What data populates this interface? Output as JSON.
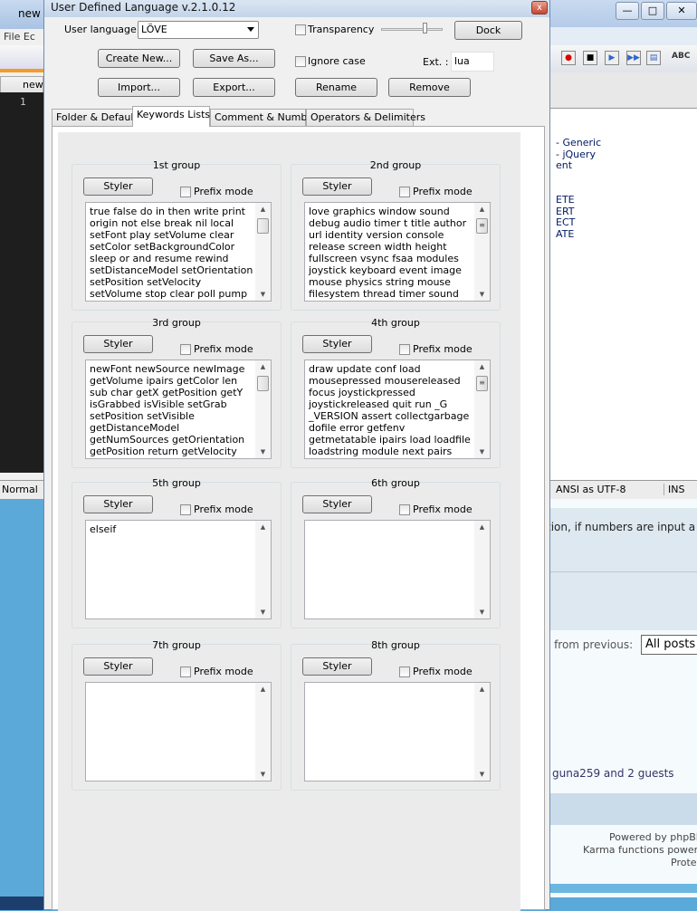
{
  "background_left": {
    "title": "new",
    "menu": "File  Ec",
    "tab": "new",
    "line_number": "1",
    "status": "Normal"
  },
  "background_right": {
    "window_controls": [
      "—",
      "□",
      "✕"
    ],
    "editor_lines": [
      "- Generic",
      "- jQuery",
      "ent",
      "",
      "",
      "ETE",
      "ERT",
      "ECT",
      "ATE"
    ],
    "status_encoding": "ANSI as UTF-8",
    "status_mode": "INS",
    "forum_text1": "tion, if numbers are input a",
    "forum_from_previous": "s from previous:",
    "forum_select": "All posts",
    "forum_users": "guna259 and 2 guests",
    "footer1": "Powered by phpBB",
    "footer2": "Karma functions power",
    "footer3": "Prote"
  },
  "dialog": {
    "title": "User Defined Language v.2.1.0.12",
    "close": "x",
    "user_language_label": "User language :",
    "user_language_value": "LÖVE",
    "transparency_label": "Transparency",
    "transparency_checked": false,
    "dock_label": "Dock",
    "create_new_label": "Create New...",
    "save_as_label": "Save As...",
    "ignore_case_label": "Ignore case",
    "ignore_case_checked": false,
    "ext_label": "Ext. :",
    "ext_value": "lua",
    "import_label": "Import...",
    "export_label": "Export...",
    "rename_label": "Rename",
    "remove_label": "Remove",
    "tabs": [
      {
        "label": "Folder & Default"
      },
      {
        "label": "Keywords Lists",
        "active": true
      },
      {
        "label": "Comment & Number"
      },
      {
        "label": "Operators & Delimiters"
      }
    ],
    "groups": [
      {
        "title": "1st group",
        "styler": "Styler",
        "prefix": "Prefix mode",
        "text": "true false do in then write print origin not else break nil local setFont play setVolume clear setColor setBackgroundColor sleep or and resume rewind setDistanceModel setOrientation setPosition setVelocity setVolume stop clear poll pump push wait init mkdir read",
        "scroll": true
      },
      {
        "title": "2nd group",
        "styler": "Styler",
        "prefix": "Prefix mode",
        "text": "love graphics window sound debug audio timer t title author url identity version console release screen width height fullscreen vsync fsaa modules joystick keyboard event image mouse physics string mouse filesystem thread timer sound coroutine debug io math os package",
        "scroll": true
      },
      {
        "title": "3rd group",
        "styler": "Styler",
        "prefix": "Prefix mode",
        "text": "newFont newSource newImage getVolume ipairs getColor len sub char getX getPosition getY isGrabbed isVisible setGrab setPosition setVisible getDistanceModel getNumSources getOrientation getPosition return getVelocity getVolume newSource enumerate",
        "scroll": true
      },
      {
        "title": "4th group",
        "styler": "Styler",
        "prefix": "Prefix mode",
        "text": "draw update conf load mousepressed mousereleased focus joystickpressed joystickreleased quit run _G _VERSION assert collectgarbage dofile error getfenv getmetatable ipairs load loadfile loadstring module next pairs pcall print rawequal rawget rawset",
        "scroll": true
      },
      {
        "title": "5th group",
        "styler": "Styler",
        "prefix": "Prefix mode",
        "text": "elseif",
        "scroll": false
      },
      {
        "title": "6th group",
        "styler": "Styler",
        "prefix": "Prefix mode",
        "text": "",
        "scroll": false
      },
      {
        "title": "7th group",
        "styler": "Styler",
        "prefix": "Prefix mode",
        "text": "",
        "scroll": false
      },
      {
        "title": "8th group",
        "styler": "Styler",
        "prefix": "Prefix mode",
        "text": "",
        "scroll": false
      }
    ]
  }
}
